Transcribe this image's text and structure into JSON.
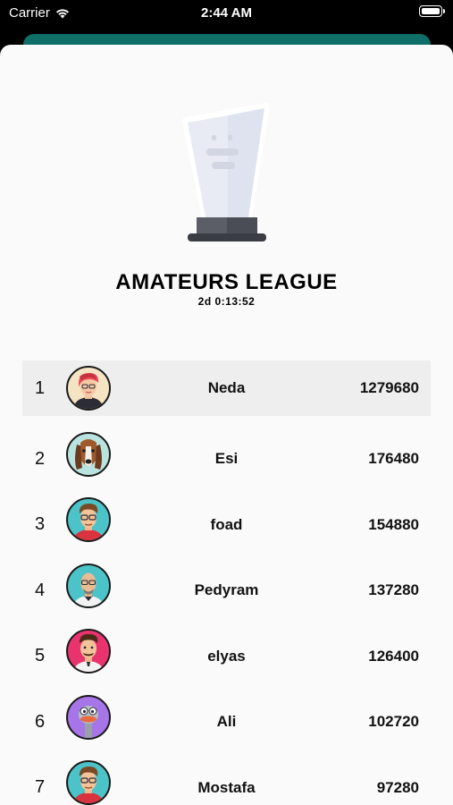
{
  "status_bar": {
    "carrier": "Carrier",
    "time": "2:44 AM"
  },
  "league": {
    "title": "AMATEURS LEAGUE",
    "time_remaining": "2d 0:13:52"
  },
  "leaderboard": [
    {
      "rank": "1",
      "name": "Neda",
      "score": "1279680",
      "avatar": "woman-red-hair-avatar",
      "avatar_bg": "#f6e3c4",
      "highlighted": true
    },
    {
      "rank": "2",
      "name": "Esi",
      "score": "176480",
      "avatar": "dog-avatar",
      "avatar_bg": "#b9e3df",
      "highlighted": false
    },
    {
      "rank": "3",
      "name": "foad",
      "score": "154880",
      "avatar": "man-glasses-avatar",
      "avatar_bg": "#4cc3c8",
      "highlighted": false
    },
    {
      "rank": "4",
      "name": "Pedyram",
      "score": "137280",
      "avatar": "man-bald-avatar",
      "avatar_bg": "#4cc3c8",
      "highlighted": false
    },
    {
      "rank": "5",
      "name": "elyas",
      "score": "126400",
      "avatar": "man-tie-avatar",
      "avatar_bg": "#e8336f",
      "highlighted": false
    },
    {
      "rank": "6",
      "name": "Ali",
      "score": "102720",
      "avatar": "ostrich-avatar",
      "avatar_bg": "#a675e8",
      "highlighted": false
    },
    {
      "rank": "7",
      "name": "Mostafa",
      "score": "97280",
      "avatar": "man-glasses-avatar",
      "avatar_bg": "#4cc3c8",
      "highlighted": false
    }
  ],
  "colors": {
    "header_accent": "#0f6e68",
    "sheet_background": "#fafafa",
    "highlight_row": "#eeeeee"
  }
}
